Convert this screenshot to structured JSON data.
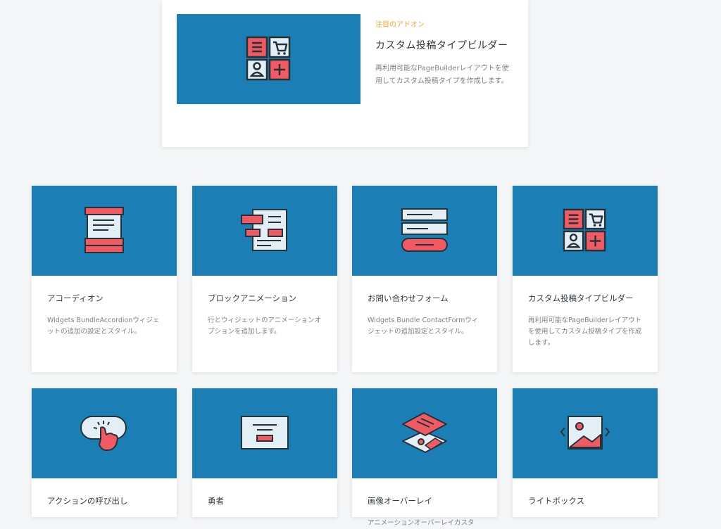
{
  "featured": {
    "tag": "注目のアドオン",
    "title": "カスタム投稿タイプビルダー",
    "description": "再利用可能なPageBuilderレイアウトを使用してカスタム投稿タイプを作成します。",
    "icon": "post-type-builder-icon"
  },
  "addons": [
    {
      "title": "アコーディオン",
      "description": "Widgets BundleAccordionウィジェットの追加の設定とスタイル。",
      "icon": "accordion-icon"
    },
    {
      "title": "ブロックアニメーション",
      "description": "行とウィジェットのアニメーションオプションを追加します。",
      "icon": "block-animation-icon"
    },
    {
      "title": "お問い合わせフォーム",
      "description": "Widgets Bundle ContactFormウィジェットの追加設定とスタイル。",
      "icon": "contact-form-icon"
    },
    {
      "title": "カスタム投稿タイプビルダー",
      "description": "再利用可能なPageBuilderレイアウトを使用してカスタム投稿タイプを作成します。",
      "icon": "post-type-builder-icon"
    },
    {
      "title": "アクションの呼び出し",
      "description": "",
      "icon": "call-to-action-icon"
    },
    {
      "title": "勇者",
      "description": "",
      "icon": "hero-icon"
    },
    {
      "title": "画像オーバーレイ",
      "description": "アニメーションオーバーレイカスタ",
      "icon": "image-overlay-icon"
    },
    {
      "title": "ライトボックス",
      "description": "",
      "icon": "lightbox-icon"
    }
  ],
  "colors": {
    "banner": "#1b7eb5",
    "accent": "#f15a63",
    "tag": "#f5a623"
  }
}
